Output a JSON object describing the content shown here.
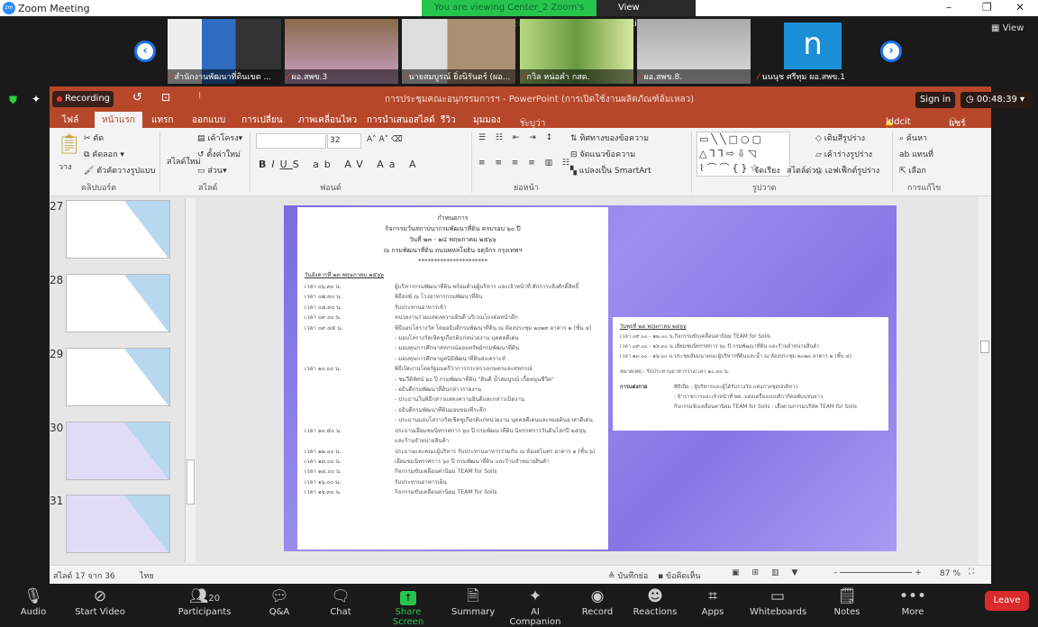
{
  "window": {
    "title": "Zoom Meeting",
    "logo": "zm",
    "banner": "You are viewing Center_2 Zoom's screen",
    "view_options": "View Options",
    "view": "View"
  },
  "participants_strip": [
    {
      "name": "สำนักงานพัฒนาที่ดินเขต ..."
    },
    {
      "name": "ผอ.สพข.3"
    },
    {
      "name": "นายสมบูรณ์ ยิ่งนิรันดร์ (ผอ..."
    },
    {
      "name": "กวิล หน่อคำ กสด."
    },
    {
      "name": "ผอ.สพข.8."
    },
    {
      "name": "นนนุช ศรีทุม ผอ.สพข.1",
      "avatar_letter": "n"
    }
  ],
  "recording": {
    "label": "Recording",
    "timer": "00:48:39",
    "sign_in": "Sign in"
  },
  "ppt": {
    "title": "การประชุมคณะอนุกรรมการฯ - PowerPoint (การเปิดใช้งานผลิตภัณฑ์ล้มเหลว)",
    "tabs": [
      "ไฟล์",
      "หน้าแรก",
      "แทรก",
      "ออกแบบ",
      "การเปลี่ยน",
      "ภาพเคลื่อนไหว",
      "การนำเสนอสไลด์",
      "รีวิว",
      "มุมมอง"
    ],
    "tell_me": "ระบุว่าคุณต้องการทำสิ่งใด...",
    "user_warn": "lddcit ldd",
    "share": "แชร์",
    "ribbon": {
      "paste": "วาง",
      "cut": "ตัด",
      "copy": "คัดลอก",
      "format_painter": "ตัวคัดวางรูปแบบ",
      "g_clipboard": "คลิปบอร์ด",
      "new_slide": "สไลด์ใหม่",
      "layout": "เค้าโครง",
      "reset": "ตั้งค่าใหม่",
      "section": "ส่วน",
      "g_slides": "สไลด์",
      "font_size": "32",
      "g_font": "ฟอนต์",
      "text_dir": "ทิศทางของข้อความ",
      "align_text": "จัดแนวข้อความ",
      "smartart": "แปลงเป็น SmartArt",
      "g_paragraph": "ย่อหน้า",
      "arrange": "จัดเรียง",
      "quick_styles": "สไตล์ด่วน",
      "fill": "เติมสีรูปร่าง",
      "outline": "เค้าร่างรูปร่าง",
      "effects": "เอฟเฟ็กต์รูปร่าง",
      "g_drawing": "รูปวาด",
      "find": "ค้นหา",
      "replace": "แทนที่",
      "select": "เลือก",
      "g_editing": "การแก้ไข"
    },
    "thumbnails": [
      27,
      28,
      29,
      30,
      31
    ],
    "status": {
      "slide": "สไลด์ 17 จาก 36",
      "lang": "ไทย",
      "notes": "บันทึกย่อ",
      "comments": "ข้อคิดเห็น",
      "zoom": "87 %"
    }
  },
  "slide": {
    "header": [
      "กำหนดการ",
      "กิจกรรมวันสถาปนากรมพัฒนาที่ดิน ครบรอบ ๖๐ ปี",
      "วันที่ ๒๓ - ๒๔ พฤษภาคม ๒๕๖๖",
      "ณ กรมพัฒนาที่ดิน ถนนพหลโยธิน จตุจักร กรุงเทพฯ",
      "**********************"
    ],
    "day1": "วันอังคารที่ ๒๓ พฤษภาคม ๒๕๖๖",
    "schedule": [
      {
        "time": "เวลา ๐๖.๓๐ น.",
        "item": "ผู้บริหารกรมพัฒนาที่ดิน พร้อมด้วยผู้บริหาร และเจ้าหน้าที่ สักการะสิ่งศักดิ์สิทธิ์"
      },
      {
        "time": "เวลา ๐๗.๓๐ น.",
        "item": "พิธีสงฆ์ ณ โรงอาหารกรมพัฒนาที่ดิน"
      },
      {
        "time": "เวลา ๐๘.๓๐ น.",
        "item": "รับประทานอาหารเช้า"
      },
      {
        "time": "เวลา ๐๙.๐๐ น.",
        "item": "หน่วยงานร่วมแสดงความยินดี บริเวณโถงต่อหน้าตึก"
      },
      {
        "time": "เวลา ๐๙.๔๕ น.",
        "item": "พิธีมอบโล่รางวัล โดยอธิบดีกรมพัฒนาที่ดิน ณ ห้องประชุม ๒๐๒๓ อาคาร ๒ (ชั้น ๔)"
      },
      {
        "time": "",
        "item": "- มอบโล่รางวัลเชิดชูเกียรติแก่หน่วยงาน บุคคลดีเด่น"
      },
      {
        "time": "",
        "item": "- มอบทุนการศึกษาสหกรณ์ออมทรัพย์กรมพัฒนาที่ดิน"
      },
      {
        "time": "",
        "item": "- มอบทุนการศึกษามูลนิธิพัฒนาที่ดินสงเคราะห์"
      },
      {
        "time": "เวลา ๑๐.๐๐ น.",
        "item": "พิธีเปิดงานโดยรัฐมนตรีว่าการกระทรวงเกษตรและสหกรณ์"
      },
      {
        "time": "",
        "item": "- ชมวีดิทัศน์ ๖๐ ปี กรมพัฒนาที่ดิน \"ดินดี น้ำสมบูรณ์ เกื้อหนุนชีวิต\""
      },
      {
        "time": "",
        "item": "- อธิบดีกรมพัฒนาที่ดินกล่าวรายงาน"
      },
      {
        "time": "",
        "item": "- ประธานในพิธีกล่าวแสดงความยินดีและกล่าวเปิดงาน"
      },
      {
        "time": "",
        "item": "- อธิบดีกรมพัฒนาที่ดินมอบของที่ระลึก"
      },
      {
        "time": "",
        "item": "- ประธานมอบโล่รางวัลเชิดชูเกียรติแก่หน่วยงาน บุคคลดีเด่นและหมอดินอาสาดีเด่น"
      },
      {
        "time": "เวลา ๑๐.๕๐ น.",
        "item": "ประธานเยี่ยมชมนิทรรศการ ๖๐ ปี กรมพัฒนาที่ดิน นิทรรศการวันดินโลกปี ๒๕๖๖"
      },
      {
        "time": "",
        "item": "และร้านจำหน่ายสินค้า"
      },
      {
        "time": "เวลา ๑๒.๐๐ น.",
        "item": "ประธานและคณะผู้บริหาร รับประทานอาหารร่วมกัน ณ ห้องสโมสร อาคาร ๑ (ชั้น ๖)"
      },
      {
        "time": "เวลา ๑๓.๐๐ น.",
        "item": "เยี่ยมชมนิทรรศการ ๖๐ ปี กรมพัฒนาที่ดิน และร้านจำหน่ายสินค้า"
      },
      {
        "time": "เวลา ๑๔.๐๐ น.",
        "item": "กิจกรรมขับเคลื่อนค่านิยม TEAM for Soils"
      },
      {
        "time": "เวลา ๑๖.๐๐ น.",
        "item": "รับประทานอาหารเย็น"
      },
      {
        "time": "เวลา ๑๖.๓๐ น.",
        "item": "กิจกรรมขับเคลื่อนค่านิยม TEAM for Soils"
      }
    ],
    "day2": "วันพุธที่ ๒๔ พฤษภาคม ๒๕๖๖",
    "schedule2": [
      {
        "time": "เวลา ๐๙.๐๐ - ๑๒.๐๐ น.",
        "item": "กิจกรรมขับเคลื่อนค่านิยม TEAM for Soils"
      },
      {
        "time": "เวลา ๐๙.๐๐ - ๑๖.๓๐ น.",
        "item": "เยี่ยมชมนิทรรศการ ๖๐ ปี กรมพัฒนาที่ดิน และร้านจำหน่ายสินค้า"
      },
      {
        "time": "เวลา ๑๓.๐๐ - ๑๖.๐๐ น.",
        "item": "ประชุมสัมมนาคณะผู้บริหารที่ดินและน้ำ ณ ห้องประชุม ๒๐๒๓ อาคาร ๒ (ชั้น ๔)"
      }
    ],
    "note": "หมายเหตุ : รับประทานอาหารว่างเวลา ๑๐.๓๐ น.",
    "dress_label": "การแต่งกาย",
    "dress": [
      "พิธีเปิด : ผู้บริหารและผู้ได้รับรางวัล แต่งกายชุดปกติขาว",
      ": ข้าราชการและเจ้าหน้าที่ พด. แต่งเครื่องแบบสีกากีคอพับแขนยาว",
      "กิจกรรมขับเคลื่อนค่านิยม TEAM for Soils : เสื้อตามกรรมบริษัท TEAM for Soils"
    ]
  },
  "toolbar": {
    "audio": "Audio",
    "video": "Start Video",
    "participants": "Participants",
    "participant_count": "20",
    "qa": "Q&A",
    "chat": "Chat",
    "share": "Share Screen",
    "summary": "Summary",
    "ai": "AI Companion",
    "record": "Record",
    "reactions": "Reactions",
    "apps": "Apps",
    "whiteboards": "Whiteboards",
    "notes": "Notes",
    "more": "More",
    "leave": "Leave"
  },
  "colors": {
    "ppt_accent": "#b7472a",
    "share_green": "#27c44d",
    "leave_red": "#d92b2b",
    "slide_purple": "#8676e6"
  }
}
